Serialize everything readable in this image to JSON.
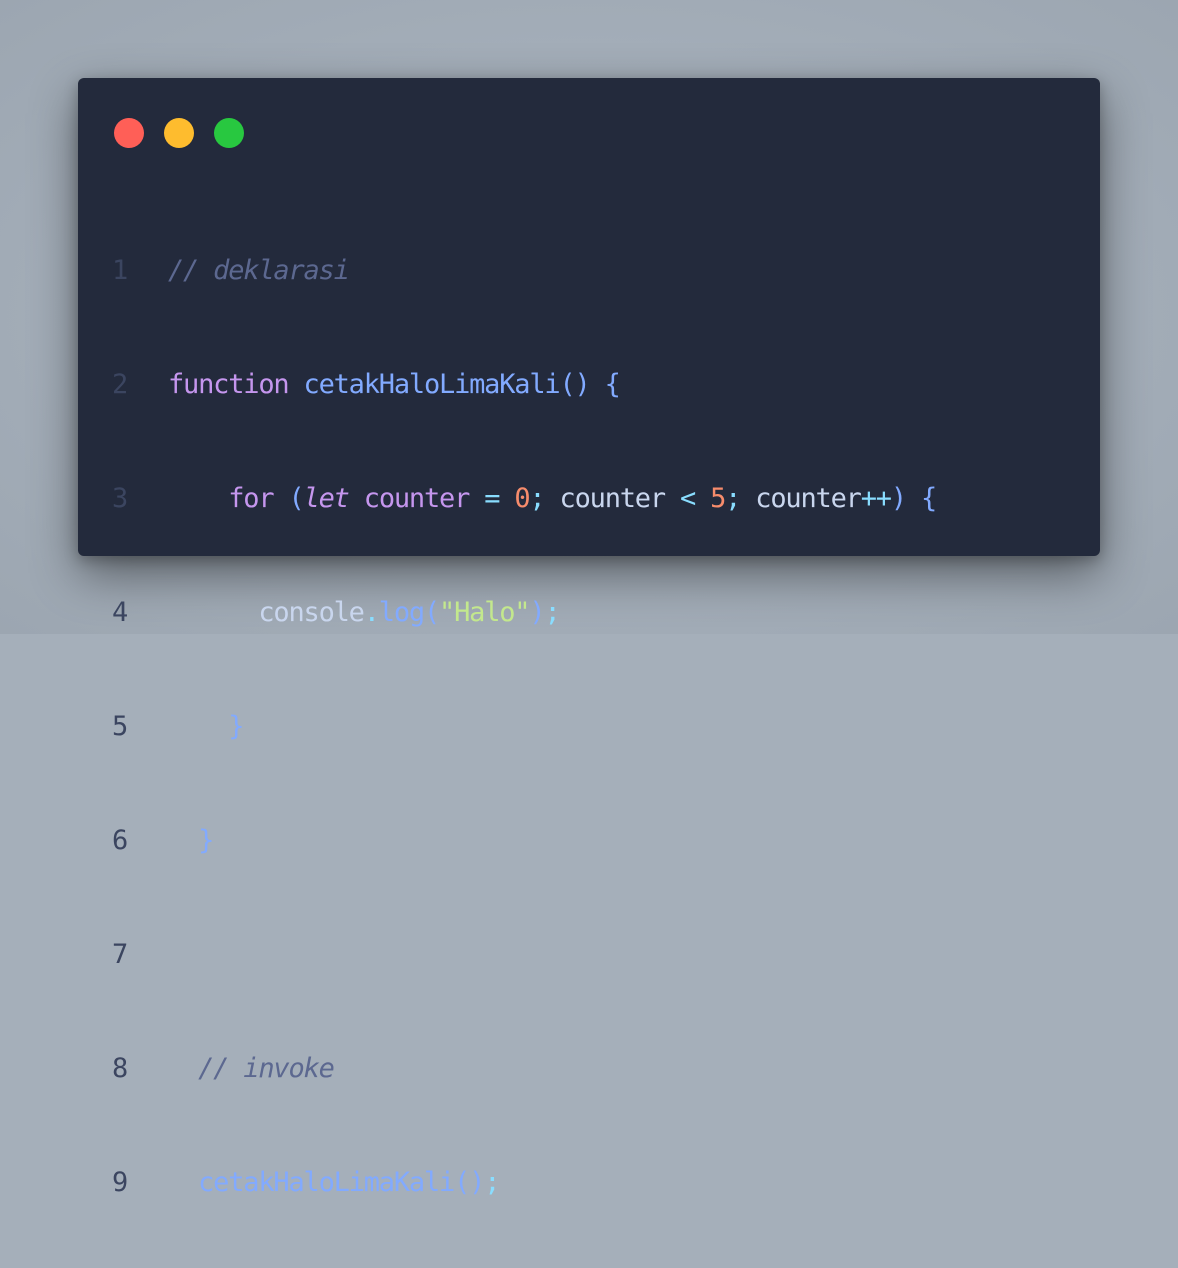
{
  "window": {
    "buttons": {
      "close_color": "#ff5f57",
      "minimize_color": "#febc2e",
      "maximize_color": "#28c840"
    }
  },
  "code": {
    "language": "javascript",
    "line_numbers": [
      "1",
      "2",
      "3",
      "4",
      "5",
      "6",
      "7",
      "8",
      "9"
    ],
    "lines": [
      "// deklarasi",
      "function cetakHaloLimaKali() {",
      "    for (let counter = 0; counter < 5; counter++) {",
      "      console.log(\"Halo\");",
      "    }",
      "  }",
      "",
      "  // invoke",
      "  cetakHaloLimaKali();"
    ],
    "tokens": {
      "l1_comment": "// deklarasi",
      "l2_keyword": "function",
      "l2_fn": "cetakHaloLimaKali",
      "l2_parens": "()",
      "l2_brace": "{",
      "l3_for": "for",
      "l3_paren_open": "(",
      "l3_let": "let",
      "l3_var1": "counter",
      "l3_eq": "=",
      "l3_zero": "0",
      "l3_semi1": ";",
      "l3_var2": "counter",
      "l3_lt": "<",
      "l3_five": "5",
      "l3_semi2": ";",
      "l3_var3": "counter",
      "l3_inc": "++",
      "l3_paren_close": ")",
      "l3_brace": "{",
      "l4_obj": "console",
      "l4_dot": ".",
      "l4_method": "log",
      "l4_paren_open": "(",
      "l4_str": "\"Halo\"",
      "l4_paren_close": ")",
      "l4_semi": ";",
      "l5_brace": "}",
      "l6_brace": "}",
      "l8_comment": "// invoke",
      "l9_fn": "cetakHaloLimaKali",
      "l9_parens": "()",
      "l9_semi": ";"
    }
  },
  "colors": {
    "background": "#a5afba",
    "editor_bg": "#232a3c",
    "comment": "#5c6890",
    "keyword": "#c596ee",
    "function": "#82aaff",
    "number": "#f78c6c",
    "string": "#c3e88d",
    "operator": "#89ddff",
    "text": "#c9d6ee",
    "line_number": "#3b4560"
  }
}
